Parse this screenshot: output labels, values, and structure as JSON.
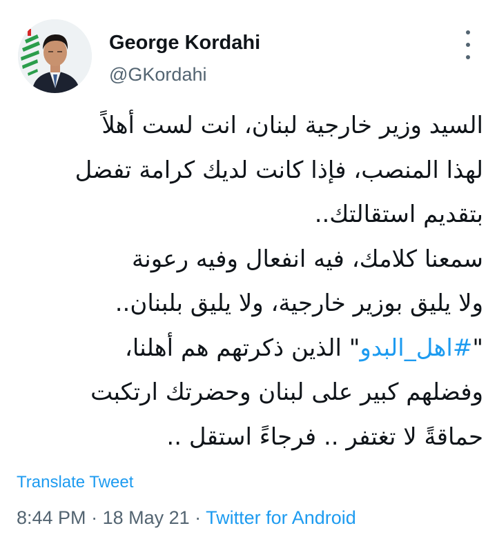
{
  "author": {
    "display_name": "George Kordahi",
    "handle": "@GKordahi",
    "avatar": "profile-photo-with-lebanese-cedar"
  },
  "more_icon": "more-horizontal-icon",
  "tweet": {
    "lines": [
      {
        "text": "السيد وزير خارجية لبنان، انت لست أهلاً"
      },
      {
        "text": "لهذا المنصب، فإذا كانت لديك كرامة تفضل"
      },
      {
        "text": "بتقديم استقالتك.."
      },
      {
        "text": "سمعنا كلامك، فيه انفعال وفيه رعونة"
      },
      {
        "text": "ولا يليق بوزير خارجية، ولا يليق بلبنان.."
      },
      {
        "pre": "\"",
        "hashtag": "#اهل_البدو",
        "post": "\" الذين ذكرتهم هم أهلنا،"
      },
      {
        "text": "وفضلهم كبير على لبنان وحضرتك ارتكبت"
      },
      {
        "text": "حماقةً لا تغتفر .. فرجاءً استقل .."
      }
    ]
  },
  "translate_label": "Translate Tweet",
  "meta": {
    "time": "8:44 PM",
    "separator": " · ",
    "date": "18 May 21",
    "source": "Twitter for Android"
  },
  "colors": {
    "link": "#1d9bf0",
    "secondary_text": "#536471",
    "primary_text": "#0f1419",
    "background": "#ffffff"
  }
}
